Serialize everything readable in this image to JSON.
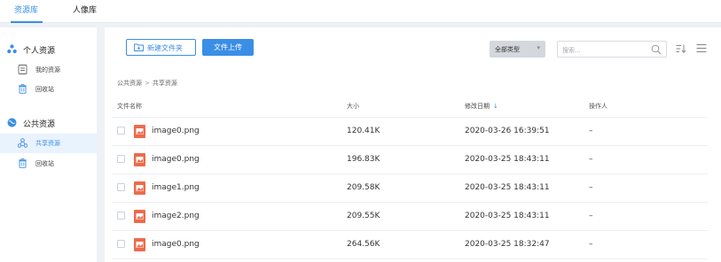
{
  "top_tabs": [
    {
      "label": "资源库",
      "active": true
    },
    {
      "label": "人像库",
      "active": false
    }
  ],
  "sidebar": {
    "groups": [
      {
        "label": "个人资源",
        "icon": "personal-resource-icon",
        "items": [
          {
            "label": "我的资源",
            "icon": "document-icon"
          },
          {
            "label": "回收站",
            "icon": "trash-icon"
          }
        ]
      },
      {
        "label": "公共资源",
        "icon": "public-resource-icon",
        "items": [
          {
            "label": "共享资源",
            "icon": "share-icon",
            "active": true
          },
          {
            "label": "回收站",
            "icon": "trash-icon"
          }
        ]
      }
    ]
  },
  "toolbar": {
    "new_folder_label": "新建文件夹",
    "upload_label": "文件上传",
    "type_select_value": "全部类型",
    "search_placeholder": "搜索..."
  },
  "breadcrumb": [
    "公共资源",
    "共享资源"
  ],
  "breadcrumb_separator": ">",
  "table": {
    "columns": [
      "文件名称",
      "大小",
      "修改日期",
      "操作人"
    ],
    "sort_indicator": "↓",
    "rows": [
      {
        "name": "image0.png",
        "size": "120.41K",
        "date": "2020-03-26 16:39:51",
        "operator": "–"
      },
      {
        "name": "image0.png",
        "size": "196.83K",
        "date": "2020-03-25 18:43:11",
        "operator": "–"
      },
      {
        "name": "image1.png",
        "size": "209.58K",
        "date": "2020-03-25 18:43:11",
        "operator": "–"
      },
      {
        "name": "image2.png",
        "size": "209.55K",
        "date": "2020-03-25 18:43:11",
        "operator": "–"
      },
      {
        "name": "image0.png",
        "size": "264.56K",
        "date": "2020-03-25 18:32:47",
        "operator": "–"
      }
    ]
  },
  "colors": {
    "accent": "#3a8ee6",
    "file_icon": "#ee6a4b",
    "page_bg": "#eef1f6",
    "active_item_bg": "#e9f3fd"
  }
}
